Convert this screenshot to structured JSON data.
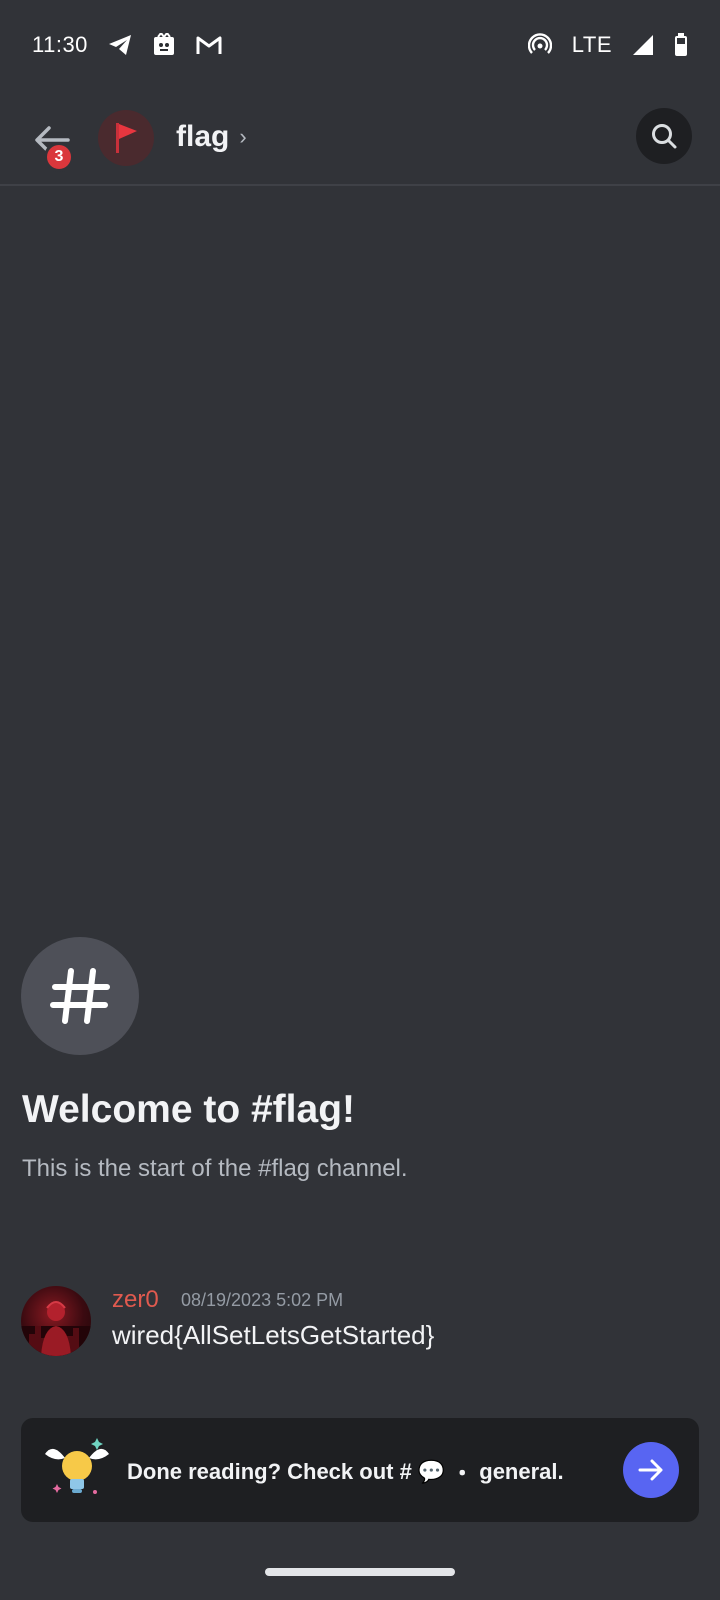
{
  "status_bar": {
    "time": "11:30",
    "network": "LTE",
    "icons": [
      "telegram-icon",
      "app-icon",
      "gmail-icon",
      "hotspot-icon",
      "signal-icon",
      "battery-icon"
    ]
  },
  "header": {
    "back_badge": "3",
    "channel_name": "flag",
    "chevron": "›",
    "avatar_icon": "flag-icon",
    "search_icon": "search-icon"
  },
  "welcome": {
    "icon_glyph": "#",
    "title": "Welcome to #flag!",
    "subtitle": "This is the start of the #flag channel."
  },
  "messages": [
    {
      "author": "zer0",
      "timestamp": "08/19/2023 5:02 PM",
      "text": "wired{AllSetLetsGetStarted}",
      "author_color": "#e05a4f"
    }
  ],
  "banner": {
    "prefix": "Done reading? Check out #",
    "emoji": "💬",
    "separator": "・",
    "channel": "general."
  },
  "colors": {
    "background": "#313338",
    "accent": "#5865f2",
    "badge": "#da373c"
  }
}
